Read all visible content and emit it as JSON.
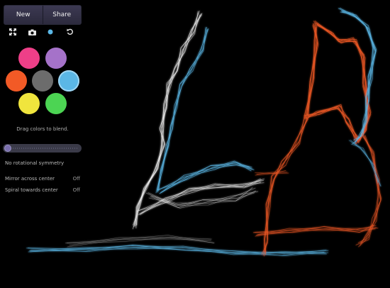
{
  "toolbar": {
    "new_label": "New",
    "share_label": "Share"
  },
  "icons": [
    "fullscreen-icon",
    "camera-icon",
    "dot-icon",
    "undo-icon"
  ],
  "colors": {
    "pink": "#ee3f88",
    "purple": "#a572c9",
    "orange": "#f25a26",
    "gray": "#6c6c6c",
    "blue": "#5bb7e6",
    "yellow": "#f0e53d",
    "green": "#4cd453",
    "accent": "#5bb7e6"
  },
  "hint": "Drag colors to blend.",
  "symmetry": {
    "label": "No rotational symmetry",
    "level": 0
  },
  "options": {
    "mirror_label": "Mirror across center",
    "mirror_value": "Off",
    "spiral_label": "Spiral towards center",
    "spiral_value": "Off"
  }
}
